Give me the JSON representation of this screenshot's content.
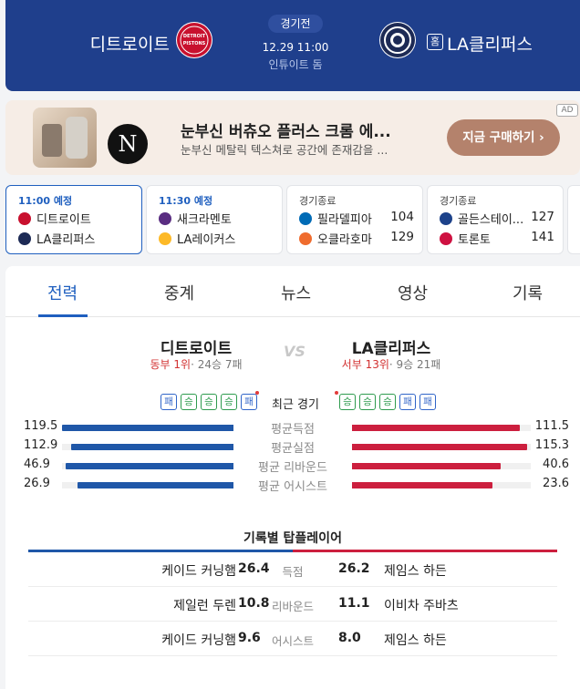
{
  "header": {
    "status": "경기전",
    "time": "12.29 11:00",
    "venue": "인튜이트 돔",
    "away_team": "디트로이트",
    "home_team": "LA클리퍼스",
    "home_badge": "홈",
    "away_logo_text": "DETROIT PISTONS",
    "colors": {
      "header_bg": "#1f3f8c",
      "away": "#1f57a8",
      "home": "#cc1f3e"
    }
  },
  "ad": {
    "brand_logo": "N",
    "title": "눈부신 버츄오 플러스 크롬 에...",
    "subtitle": "눈부신 메탈릭 텍스쳐로 공간에 존재감을 ...",
    "cta": "지금 구매하기 ›",
    "tag": "AD"
  },
  "schedule": [
    {
      "status": "11:00 예정",
      "teams": [
        {
          "name": "디트로이트",
          "score": "",
          "icon": "pistons-logo-icon"
        },
        {
          "name": "LA클리퍼스",
          "score": "",
          "icon": "clippers-logo-icon"
        }
      ]
    },
    {
      "status": "11:30 예정",
      "teams": [
        {
          "name": "새크라멘토",
          "score": "",
          "icon": "kings-logo-icon"
        },
        {
          "name": "LA레이커스",
          "score": "",
          "icon": "lakers-logo-icon"
        }
      ]
    },
    {
      "status": "경기종료",
      "teams": [
        {
          "name": "필라델피아",
          "score": "104",
          "icon": "76ers-logo-icon"
        },
        {
          "name": "오클라호마",
          "score": "129",
          "icon": "thunder-logo-icon"
        }
      ]
    },
    {
      "status": "경기종료",
      "teams": [
        {
          "name": "골든스테이...",
          "score": "127",
          "icon": "warriors-logo-icon"
        },
        {
          "name": "토론토",
          "score": "141",
          "icon": "raptors-logo-icon"
        }
      ]
    }
  ],
  "tabs": [
    "전력",
    "중계",
    "뉴스",
    "영상",
    "기록"
  ],
  "matchup": {
    "vs": "VS",
    "away": {
      "name": "디트로이트",
      "conf": "동부",
      "rank": "1위",
      "record": "· 24승 7패"
    },
    "home": {
      "name": "LA클리퍼스",
      "conf": "서부",
      "rank": "13위",
      "record": "· 9승 21패"
    }
  },
  "recent": {
    "label": "최근 경기",
    "away": [
      "패",
      "승",
      "승",
      "승",
      "패"
    ],
    "home": [
      "승",
      "승",
      "승",
      "패",
      "패"
    ]
  },
  "stats": [
    {
      "label": "평균득점",
      "away": "119.5",
      "home": "111.5",
      "away_frac": 1.0,
      "home_frac": 0.94
    },
    {
      "label": "평균실점",
      "away": "112.9",
      "home": "115.3",
      "away_frac": 0.95,
      "home_frac": 0.98
    },
    {
      "label": "평균 리바운드",
      "away": "46.9",
      "home": "40.6",
      "away_frac": 0.98,
      "home_frac": 0.84
    },
    {
      "label": "평균 어시스트",
      "away": "26.9",
      "home": "23.6",
      "away_frac": 0.92,
      "home_frac": 0.8
    }
  ],
  "leaders": {
    "title": "기록별 탑플레이어",
    "rows": [
      {
        "away_player": "케이드 커닝햄",
        "away_val": "26.4",
        "cat": "득점",
        "home_val": "26.2",
        "home_player": "제임스 하든"
      },
      {
        "away_player": "제일런 두렌",
        "away_val": "10.8",
        "cat": "리바운드",
        "home_val": "11.1",
        "home_player": "이비차 주바츠"
      },
      {
        "away_player": "케이드 커닝햄",
        "away_val": "9.6",
        "cat": "어시스트",
        "home_val": "8.0",
        "home_player": "제임스 하든"
      }
    ]
  }
}
